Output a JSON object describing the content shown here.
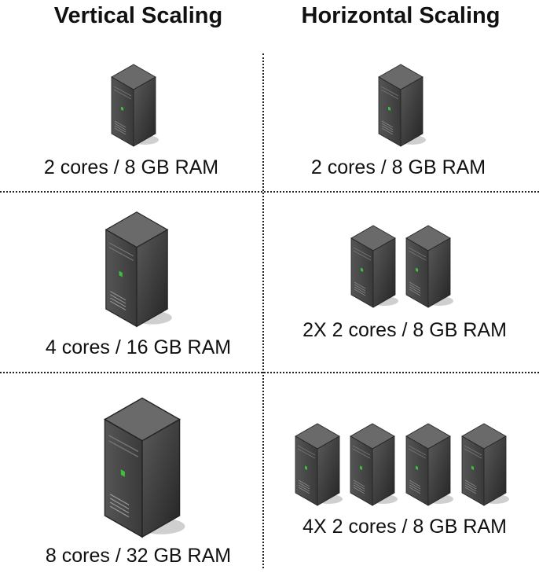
{
  "headings": {
    "vertical": "Vertical Scaling",
    "horizontal": "Horizontal Scaling"
  },
  "vertical": [
    {
      "label": "2 cores / 8 GB RAM",
      "icon": "server-tower-icon"
    },
    {
      "label": "4 cores / 16 GB RAM",
      "icon": "server-tower-icon"
    },
    {
      "label": "8 cores / 32 GB RAM",
      "icon": "server-tower-icon"
    }
  ],
  "horizontal": [
    {
      "label": "2 cores / 8 GB RAM",
      "count": 1,
      "icon": "server-tower-icon"
    },
    {
      "label": "2X  2 cores / 8 GB RAM",
      "count": 2,
      "icon": "server-tower-icon"
    },
    {
      "label": "4X  2 cores / 8 GB RAM",
      "count": 4,
      "icon": "server-tower-icon"
    }
  ],
  "colors": {
    "server_front": "#3a3a3a",
    "server_side": "#242424",
    "server_top": "#6a6a6a",
    "led": "#3fbf3f"
  }
}
